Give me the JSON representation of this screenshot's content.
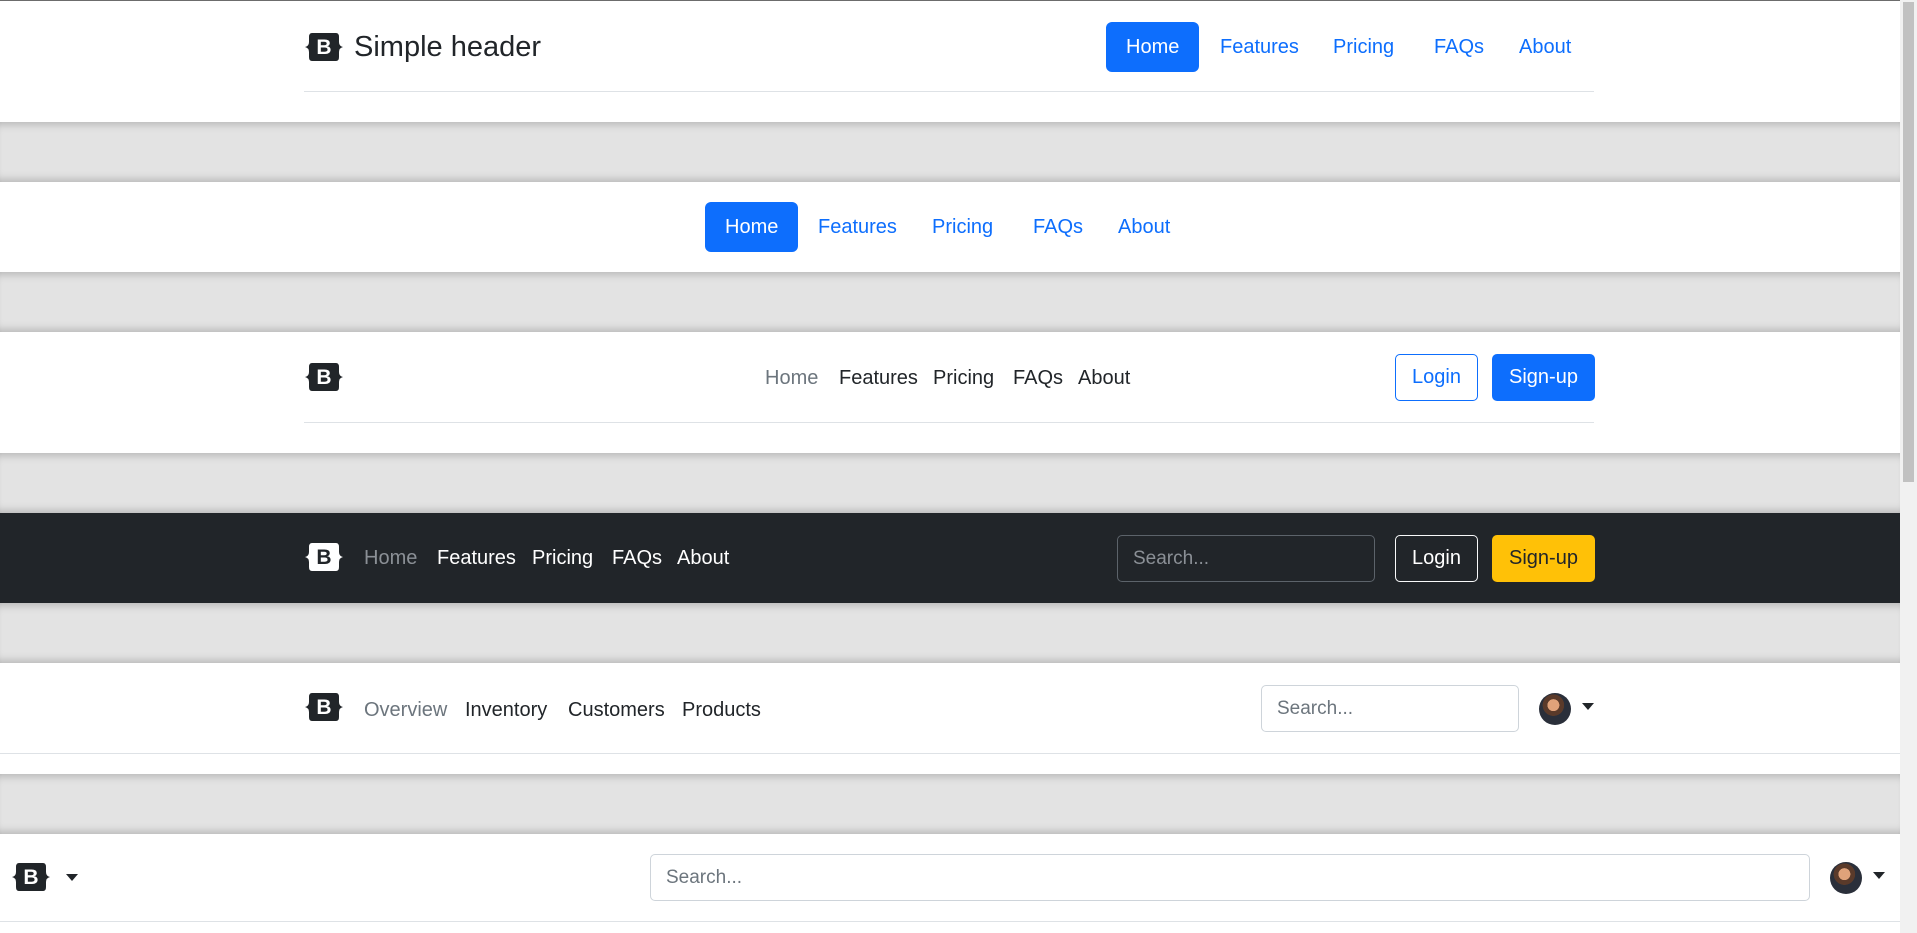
{
  "colors": {
    "primary": "#0d6efd",
    "dark_bar": "#212529",
    "warning": "#ffc107",
    "divider": "#e3e3e3"
  },
  "logo_glyph": "B",
  "header1": {
    "brand": "Simple header",
    "nav": [
      "Home",
      "Features",
      "Pricing",
      "FAQs",
      "About"
    ],
    "active": "Home"
  },
  "header2": {
    "nav": [
      "Home",
      "Features",
      "Pricing",
      "FAQs",
      "About"
    ],
    "active": "Home"
  },
  "header3": {
    "nav": [
      "Home",
      "Features",
      "Pricing",
      "FAQs",
      "About"
    ],
    "login": "Login",
    "signup": "Sign-up"
  },
  "header4": {
    "nav": [
      "Home",
      "Features",
      "Pricing",
      "FAQs",
      "About"
    ],
    "search_placeholder": "Search...",
    "login": "Login",
    "signup": "Sign-up"
  },
  "header5": {
    "nav": [
      "Overview",
      "Inventory",
      "Customers",
      "Products"
    ],
    "search_placeholder": "Search..."
  },
  "header6": {
    "search_placeholder": "Search..."
  },
  "icons": {
    "logo": "bootstrap-logo-icon",
    "avatar": "user-avatar",
    "caret": "caret-down-icon"
  }
}
